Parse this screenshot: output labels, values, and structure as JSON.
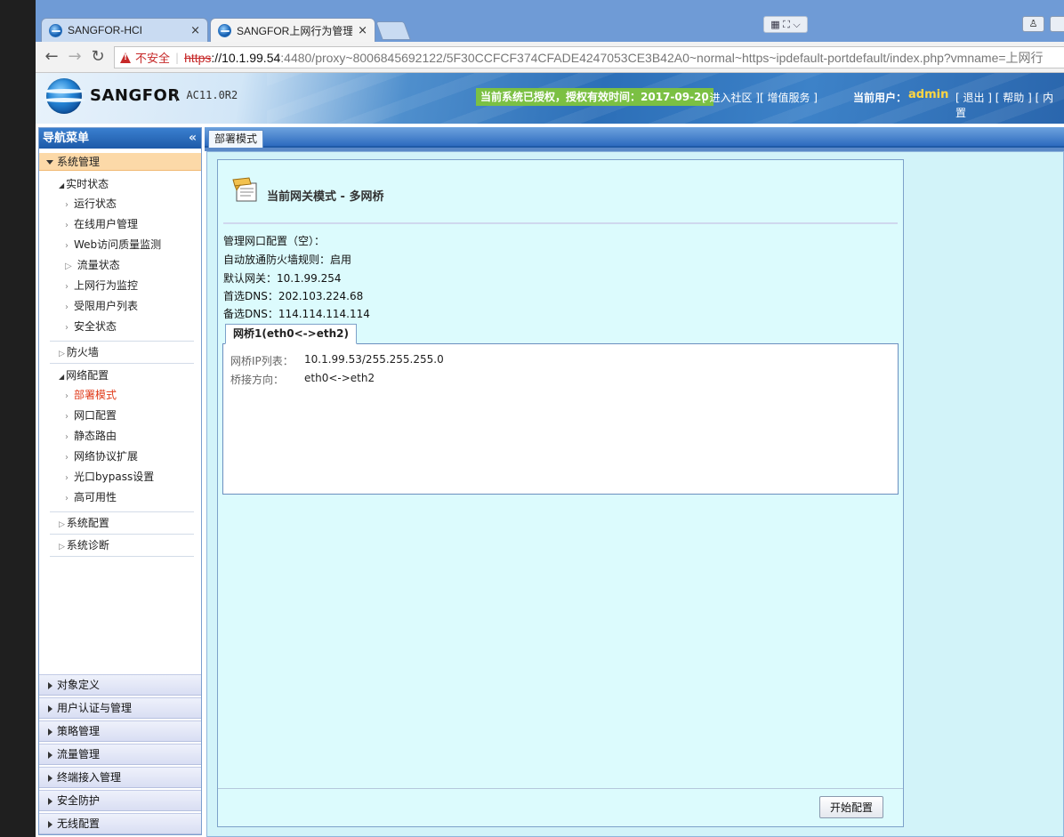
{
  "browser": {
    "tabs": [
      {
        "title": "SANGFOR-HCI",
        "close": "×"
      },
      {
        "title": "SANGFOR上网行为管理",
        "close": "×"
      }
    ],
    "nav": {
      "back": "←",
      "forward": "→",
      "reload": "↻"
    },
    "address": {
      "security_label": "不安全",
      "scheme": "https",
      "host": "://10.1.99.54",
      "rest": ":4480/proxy~8006845692122/5F30CCFCF374CFADE4247053CE3B42A0~normal~https~ipdefault-portdefault/index.php?vmname=上网行"
    }
  },
  "header": {
    "logo": "SANGFOR",
    "version": "AC11.0R2",
    "license": "当前系统已授权，授权有效时间：2017-09-20",
    "community": "[ 进入社区 ][ 增值服务 ]",
    "user_label": "当前用户：",
    "user_name": "admin",
    "links": "[ 退出 ] [ 帮助 ] [ 内置"
  },
  "sidebar": {
    "title": "导航菜单",
    "collapse": "«",
    "system_section": "系统管理",
    "realtime": {
      "label": "实时状态",
      "items": [
        "运行状态",
        "在线用户管理",
        "Web访问质量监测",
        "流量状态",
        "上网行为监控",
        "受限用户列表",
        "安全状态"
      ]
    },
    "firewall": "防火墙",
    "network": {
      "label": "网络配置",
      "items": [
        "部署模式",
        "网口配置",
        "静态路由",
        "网络协议扩展",
        "光口bypass设置",
        "高可用性"
      ]
    },
    "sysconfig": "系统配置",
    "diagnose": "系统诊断",
    "bottom_sections": [
      "对象定义",
      "用户认证与管理",
      "策略管理",
      "流量管理",
      "终端接入管理",
      "安全防护",
      "无线配置"
    ]
  },
  "main": {
    "tab_label": "部署模式",
    "panel_title": "当前网关模式 - 多网桥",
    "info": [
      "管理网口配置（空）：",
      "自动放通防火墙规则：启用",
      "默认网关：10.1.99.254",
      "首选DNS：202.103.224.68",
      "备选DNS：114.114.114.114"
    ],
    "bridge_tab": "网桥1(eth0<->eth2)",
    "bridge": {
      "ip_label": "网桥IP列表：",
      "ip_value": "10.1.99.53/255.255.255.0",
      "dir_label": "桥接方向：",
      "dir_value": "eth0<->eth2"
    },
    "start_button": "开始配置"
  }
}
